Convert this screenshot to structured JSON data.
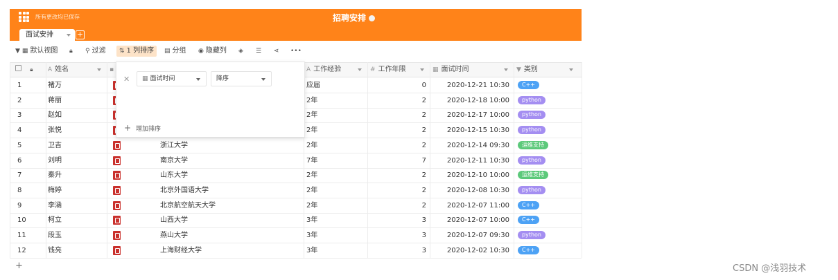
{
  "header": {
    "saved_text": "所有更改均已保存",
    "title": "招聘安排",
    "tab_label": "面试安排",
    "add_tab": "+"
  },
  "toolbar": {
    "default_view": "默认视图",
    "filter": "过滤",
    "sort": "1 列排序",
    "group": "分组",
    "hide_columns": "隐藏列"
  },
  "columns": {
    "name": "姓名",
    "experience": "工作经验",
    "years": "工作年限",
    "interview_time": "面试时间",
    "category": "类别"
  },
  "sort_panel": {
    "field": "面试时间",
    "order": "降序",
    "add_label": "增加排序"
  },
  "colors": {
    "brand": "#ff8319",
    "tag_cpp": "#4da2f5",
    "tag_python": "#a48ef1",
    "tag_ops": "#5cc97a"
  },
  "rows": [
    {
      "no": "1",
      "name": "褚万",
      "school": "",
      "exp": "应届",
      "years": "0",
      "time": "2020-12-21 10:30",
      "tag": "C++",
      "tag_type": "cpp"
    },
    {
      "no": "2",
      "name": "蒋丽",
      "school": "",
      "exp": "2年",
      "years": "2",
      "time": "2020-12-18 10:00",
      "tag": "python",
      "tag_type": "python"
    },
    {
      "no": "3",
      "name": "赵如",
      "school": "",
      "exp": "2年",
      "years": "2",
      "time": "2020-12-17 10:00",
      "tag": "python",
      "tag_type": "python"
    },
    {
      "no": "4",
      "name": "张悦",
      "school": "",
      "exp": "2年",
      "years": "2",
      "time": "2020-12-15 10:30",
      "tag": "python",
      "tag_type": "python"
    },
    {
      "no": "5",
      "name": "卫吉",
      "school": "浙江大学",
      "exp": "2年",
      "years": "2",
      "time": "2020-12-14 09:30",
      "tag": "运维支持",
      "tag_type": "ops"
    },
    {
      "no": "6",
      "name": "刘明",
      "school": "南京大学",
      "exp": "7年",
      "years": "7",
      "time": "2020-12-11 10:30",
      "tag": "python",
      "tag_type": "python"
    },
    {
      "no": "7",
      "name": "秦升",
      "school": "山东大学",
      "exp": "2年",
      "years": "2",
      "time": "2020-12-10 10:00",
      "tag": "运维支持",
      "tag_type": "ops"
    },
    {
      "no": "8",
      "name": "梅婷",
      "school": "北京外国语大学",
      "exp": "2年",
      "years": "2",
      "time": "2020-12-08 10:30",
      "tag": "python",
      "tag_type": "python"
    },
    {
      "no": "9",
      "name": "李涵",
      "school": "北京航空航天大学",
      "exp": "2年",
      "years": "2",
      "time": "2020-12-07 11:00",
      "tag": "C++",
      "tag_type": "cpp"
    },
    {
      "no": "10",
      "name": "柯立",
      "school": "山西大学",
      "exp": "3年",
      "years": "3",
      "time": "2020-12-07 10:00",
      "tag": "C++",
      "tag_type": "cpp"
    },
    {
      "no": "11",
      "name": "段玉",
      "school": "燕山大学",
      "exp": "3年",
      "years": "3",
      "time": "2020-12-07 09:30",
      "tag": "python",
      "tag_type": "python"
    },
    {
      "no": "12",
      "name": "钱亮",
      "school": "上海财经大学",
      "exp": "3年",
      "years": "3",
      "time": "2020-12-02 10:30",
      "tag": "C++",
      "tag_type": "cpp"
    }
  ],
  "footer": {
    "add_row": "+",
    "watermark": "CSDN @浅羽技术"
  }
}
